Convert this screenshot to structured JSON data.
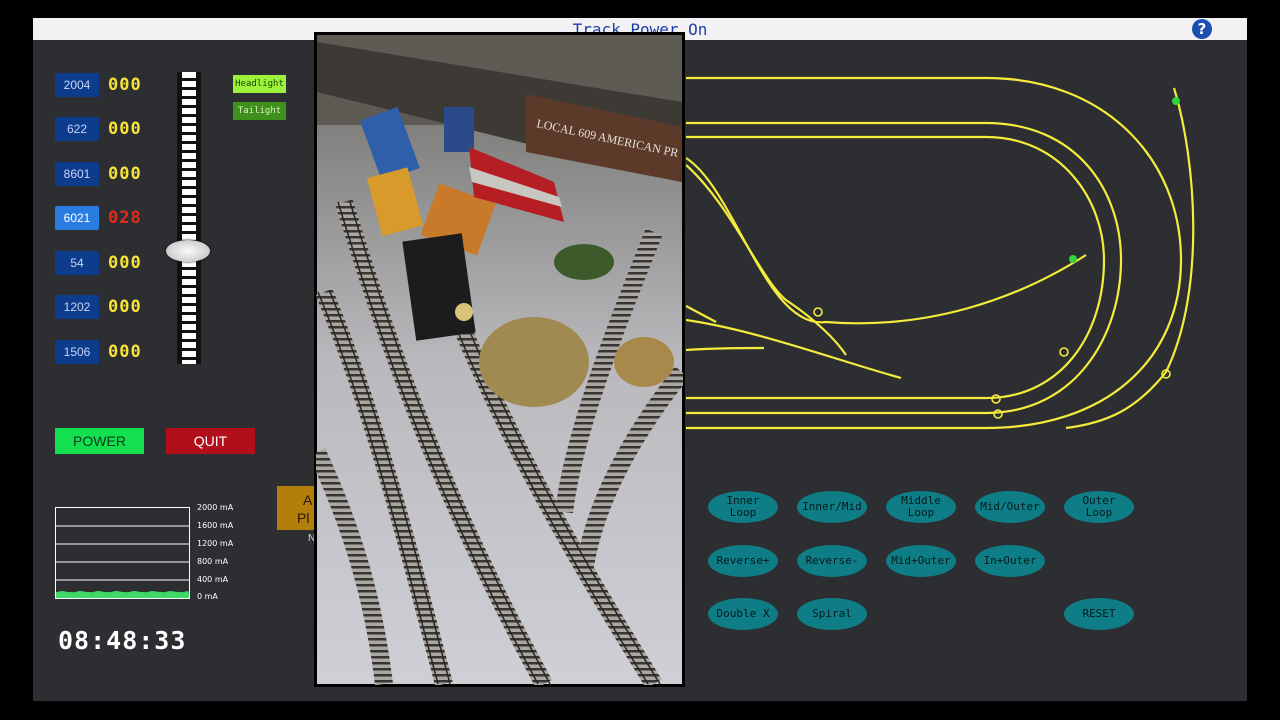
{
  "header": {
    "title": "Track Power On",
    "help_icon": "?"
  },
  "locomotives": [
    {
      "id": "2004",
      "speed": "000",
      "active": false
    },
    {
      "id": "622",
      "speed": "000",
      "active": false
    },
    {
      "id": "8601",
      "speed": "000",
      "active": false
    },
    {
      "id": "6021",
      "speed": "028",
      "active": true
    },
    {
      "id": "54",
      "speed": "000",
      "active": false
    },
    {
      "id": "1202",
      "speed": "000",
      "active": false
    },
    {
      "id": "1506",
      "speed": "000",
      "active": false
    }
  ],
  "lights": {
    "headlight": "Headlight",
    "taillight": "Tailight"
  },
  "controls": {
    "power": "POWER",
    "quit": "QUIT"
  },
  "current_meter": {
    "labels": [
      "2000 mA",
      "1600 mA",
      "1200 mA",
      "800 mA",
      "400 mA",
      "0 mA"
    ],
    "level_fraction": 0.07
  },
  "clock": "08:48:33",
  "partial_panel": {
    "line1": "A",
    "line2": "Pl",
    "line3": "N"
  },
  "routes": [
    [
      "Inner\nLoop",
      "Inner/Mid",
      "Middle\nLoop",
      "Mid/Outer",
      "Outer\nLoop"
    ],
    [
      "Reverse+",
      "Reverse-",
      "Mid+Outer",
      "In+Outer"
    ],
    [
      "Double X",
      "Spiral",
      "RESET"
    ]
  ],
  "colors": {
    "track": "#f4ec3c",
    "route_button": "#0e7d86",
    "active_loco": "#2a7de0",
    "power": "#12e04e",
    "quit": "#b10f1a"
  }
}
